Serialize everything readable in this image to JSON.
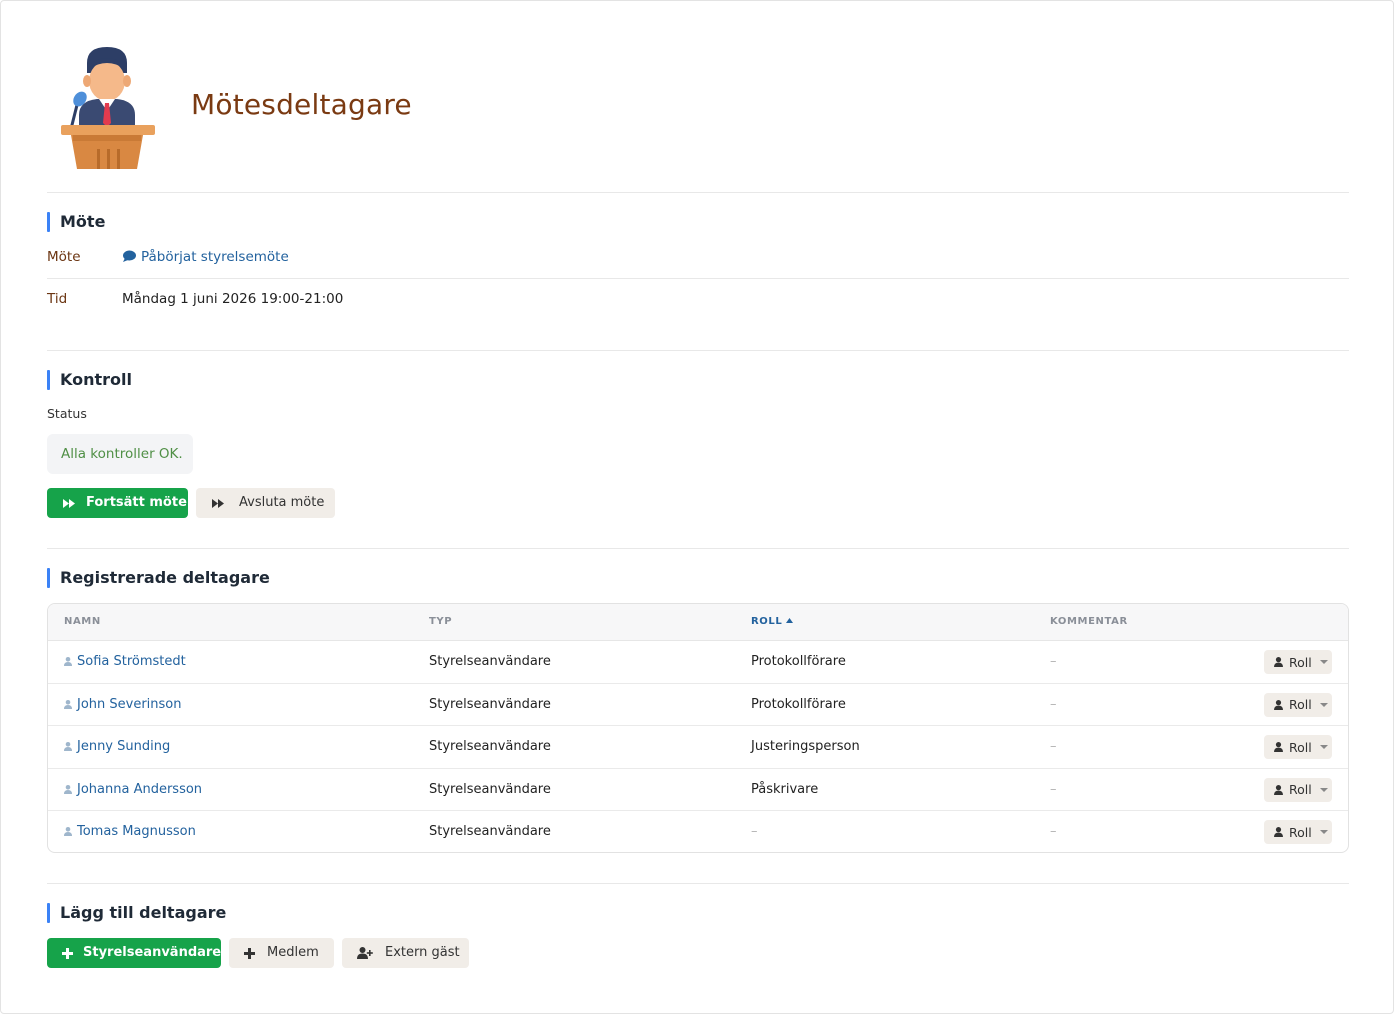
{
  "page": {
    "title": "Mötesdeltagare"
  },
  "icons": {
    "logo": "speaker-at-podium-icon",
    "meeting_link": "chat-bubble-icon",
    "continue": "fast-forward-icon",
    "end": "fast-forward-icon",
    "user": "user-icon",
    "role_menu": "user-icon",
    "add": "plus-icon",
    "guest": "user-plus-icon"
  },
  "colors": {
    "title": "#7a3a12",
    "accent_bar": "#3b82f6",
    "link": "#23629e",
    "primary_button": "#16a34a",
    "secondary_button": "#f1ede8",
    "status_ok": "#4f8f45"
  },
  "mote_section": {
    "heading": "Möte",
    "meeting_label": "Möte",
    "meeting_value": "Påbörjat styrelsemöte",
    "time_label": "Tid",
    "time_value": "Måndag 1 juni 2026 19:00-21:00"
  },
  "kontroll_section": {
    "heading": "Kontroll",
    "status_label": "Status",
    "status_value": "Alla kontroller OK.",
    "continue_button": "Fortsätt möte",
    "end_button": "Avsluta möte"
  },
  "participants_section": {
    "heading": "Registrerade deltagare",
    "columns": {
      "name": "NAMN",
      "type": "TYP",
      "role": "ROLL",
      "comment": "KOMMENTAR"
    },
    "sorted_column": "ROLL",
    "sort_direction": "ascending",
    "role_button_label": "Roll",
    "rows": [
      {
        "name": "Sofia Strömstedt",
        "type": "Styrelseanvändare",
        "role": "Protokollförare",
        "comment": "–"
      },
      {
        "name": "John Severinson",
        "type": "Styrelseanvändare",
        "role": "Protokollförare",
        "comment": "–"
      },
      {
        "name": "Jenny Sunding",
        "type": "Styrelseanvändare",
        "role": "Justeringsperson",
        "comment": "–"
      },
      {
        "name": "Johanna Andersson",
        "type": "Styrelseanvändare",
        "role": "Påskrivare",
        "comment": "–"
      },
      {
        "name": "Tomas Magnusson",
        "type": "Styrelseanvändare",
        "role": "–",
        "comment": "–"
      }
    ]
  },
  "add_section": {
    "heading": "Lägg till deltagare",
    "board_user_button": "Styrelseanvändare",
    "member_button": "Medlem",
    "guest_button": "Extern gäst"
  }
}
